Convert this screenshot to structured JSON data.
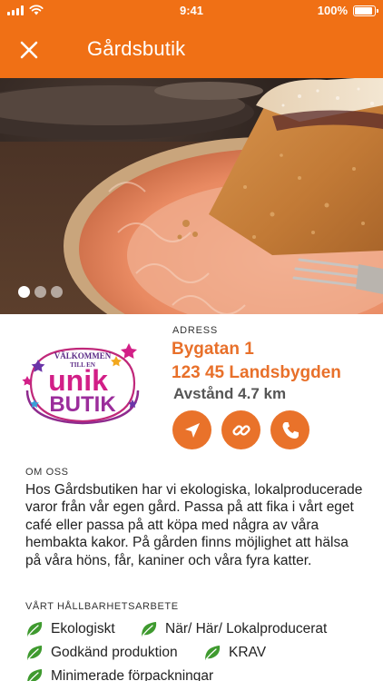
{
  "status_bar": {
    "time": "9:41",
    "battery": "100%",
    "battery_level": 1.0
  },
  "header": {
    "title": "Gårdsbutik"
  },
  "carousel": {
    "slide_count": 3,
    "active_index": 0
  },
  "store": {
    "logo_text": [
      "VÄLKOMMEN",
      "TILL EN",
      "unik",
      "BUTIK"
    ],
    "address_label": "ADRESS",
    "street": "Bygatan 1",
    "postal_city": "123 45 Landsbygden",
    "distance": "Avstånd 4.7 km"
  },
  "actions": {
    "icons": [
      "navigate-icon",
      "link-icon",
      "phone-icon"
    ]
  },
  "about": {
    "label": "OM OSS",
    "text": "Hos Gårdsbutiken har vi ekologiska, lokalproducerade varor från vår egen gård. Passa på att fika i vårt eget café eller passa på att köpa med några av våra hembakta kakor. På gården finns möjlighet att hälsa på våra höns, får, kaniner och våra fyra katter."
  },
  "sustainability": {
    "label": "VÅRT HÅLLBARHETSARBETE",
    "tags": [
      "Ekologiskt",
      "När/ Här/ Lokalproducerat",
      "Godkänd produktion",
      "KRAV",
      "Minimerade förpackningar"
    ]
  },
  "colors": {
    "accent": "#f07015",
    "accent_text": "#e8702a",
    "leaf": "#3f9a2f"
  }
}
